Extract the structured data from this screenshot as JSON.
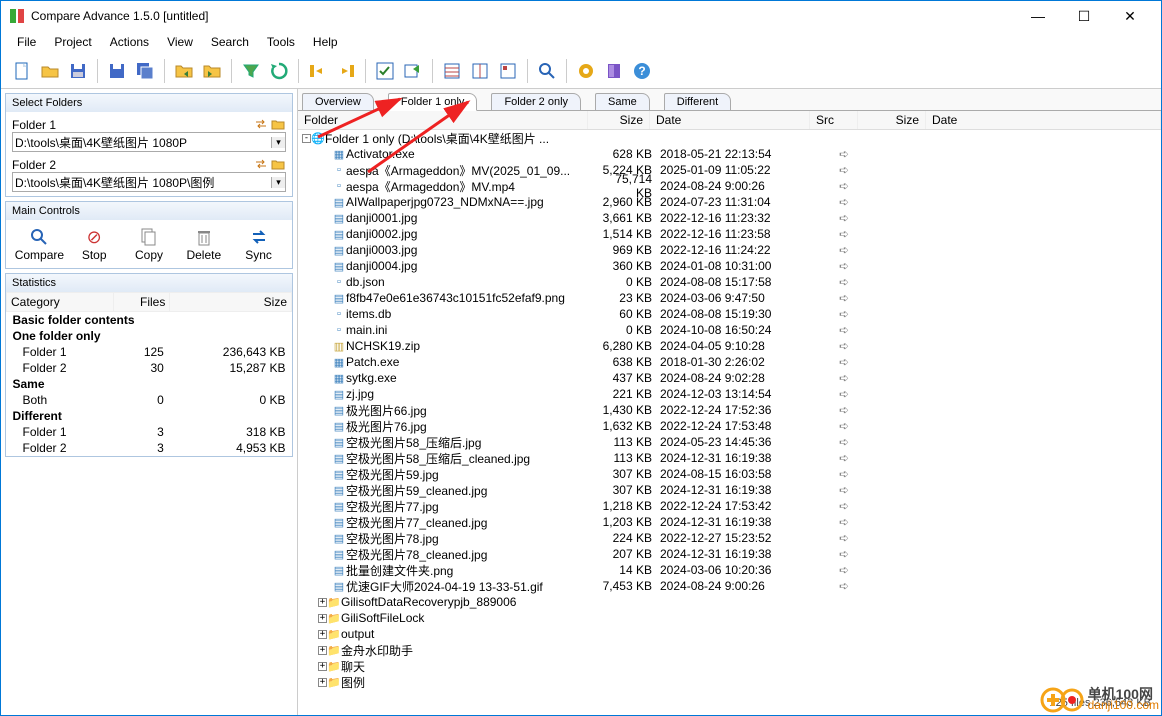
{
  "window": {
    "title": "Compare Advance 1.5.0 [untitled]"
  },
  "menu": [
    "File",
    "Project",
    "Actions",
    "View",
    "Search",
    "Tools",
    "Help"
  ],
  "sidebar": {
    "select_folders": {
      "title": "Select Folders",
      "folder1_label": "Folder 1",
      "folder1_path": "D:\\tools\\桌面\\4K壁纸图片 1080P",
      "folder2_label": "Folder 2",
      "folder2_path": "D:\\tools\\桌面\\4K壁纸图片 1080P\\图例"
    },
    "main_controls": {
      "title": "Main Controls",
      "buttons": [
        "Compare",
        "Stop",
        "Copy",
        "Delete",
        "Sync"
      ]
    },
    "statistics": {
      "title": "Statistics",
      "headers": [
        "Category",
        "Files",
        "Size"
      ],
      "groups": [
        {
          "label": "Basic folder contents"
        },
        {
          "label": "One folder only",
          "rows": [
            {
              "label": "Folder 1",
              "files": "125",
              "size": "236,643 KB"
            },
            {
              "label": "Folder 2",
              "files": "30",
              "size": "15,287 KB"
            }
          ]
        },
        {
          "label": "Same",
          "rows": [
            {
              "label": "Both",
              "files": "0",
              "size": "0 KB"
            }
          ]
        },
        {
          "label": "Different",
          "rows": [
            {
              "label": "Folder 1",
              "files": "3",
              "size": "318 KB"
            },
            {
              "label": "Folder 2",
              "files": "3",
              "size": "4,953 KB"
            }
          ]
        }
      ]
    }
  },
  "tabs": [
    "Overview",
    "Folder 1 only",
    "Folder 2 only",
    "Same",
    "Different"
  ],
  "columns": [
    "Folder",
    "Size",
    "Date",
    "Src",
    "Size",
    "Date"
  ],
  "root_label": "Folder 1 only (D:\\tools\\桌面\\4K壁纸图片 ...",
  "files": [
    {
      "name": "Activator.exe",
      "size": "628 KB",
      "date": "2018-05-21 22:13:54",
      "ico": "exe"
    },
    {
      "name": "aespa《Armageddon》MV(2025_01_09...",
      "size": "5,224 KB",
      "date": "2025-01-09 11:05:22",
      "ico": "file"
    },
    {
      "name": "aespa《Armageddon》MV.mp4",
      "size": "75,714 KB",
      "date": "2024-08-24 9:00:26",
      "ico": "file"
    },
    {
      "name": "AIWallpaperjpg0723_NDMxNA==.jpg",
      "size": "2,960 KB",
      "date": "2024-07-23 11:31:04",
      "ico": "img"
    },
    {
      "name": "danji0001.jpg",
      "size": "3,661 KB",
      "date": "2022-12-16 11:23:32",
      "ico": "img"
    },
    {
      "name": "danji0002.jpg",
      "size": "1,514 KB",
      "date": "2022-12-16 11:23:58",
      "ico": "img"
    },
    {
      "name": "danji0003.jpg",
      "size": "969 KB",
      "date": "2022-12-16 11:24:22",
      "ico": "img"
    },
    {
      "name": "danji0004.jpg",
      "size": "360 KB",
      "date": "2024-01-08 10:31:00",
      "ico": "img"
    },
    {
      "name": "db.json",
      "size": "0 KB",
      "date": "2024-08-08 15:17:58",
      "ico": "file"
    },
    {
      "name": "f8fb47e0e61e36743c10151fc52efaf9.png",
      "size": "23 KB",
      "date": "2024-03-06 9:47:50",
      "ico": "img"
    },
    {
      "name": "items.db",
      "size": "60 KB",
      "date": "2024-08-08 15:19:30",
      "ico": "file"
    },
    {
      "name": "main.ini",
      "size": "0 KB",
      "date": "2024-10-08 16:50:24",
      "ico": "file"
    },
    {
      "name": "NCHSK19.zip",
      "size": "6,280 KB",
      "date": "2024-04-05 9:10:28",
      "ico": "zip"
    },
    {
      "name": "Patch.exe",
      "size": "638 KB",
      "date": "2018-01-30 2:26:02",
      "ico": "exe"
    },
    {
      "name": "sytkg.exe",
      "size": "437 KB",
      "date": "2024-08-24 9:02:28",
      "ico": "exe"
    },
    {
      "name": "zj.jpg",
      "size": "221 KB",
      "date": "2024-12-03 13:14:54",
      "ico": "img"
    },
    {
      "name": "极光图片66.jpg",
      "size": "1,430 KB",
      "date": "2022-12-24 17:52:36",
      "ico": "img"
    },
    {
      "name": "极光图片76.jpg",
      "size": "1,632 KB",
      "date": "2022-12-24 17:53:48",
      "ico": "img"
    },
    {
      "name": "空极光图片58_压缩后.jpg",
      "size": "113 KB",
      "date": "2024-05-23 14:45:36",
      "ico": "img"
    },
    {
      "name": "空极光图片58_压缩后_cleaned.jpg",
      "size": "113 KB",
      "date": "2024-12-31 16:19:38",
      "ico": "img"
    },
    {
      "name": "空极光图片59.jpg",
      "size": "307 KB",
      "date": "2024-08-15 16:03:58",
      "ico": "img"
    },
    {
      "name": "空极光图片59_cleaned.jpg",
      "size": "307 KB",
      "date": "2024-12-31 16:19:38",
      "ico": "img"
    },
    {
      "name": "空极光图片77.jpg",
      "size": "1,218 KB",
      "date": "2022-12-24 17:53:42",
      "ico": "img"
    },
    {
      "name": "空极光图片77_cleaned.jpg",
      "size": "1,203 KB",
      "date": "2024-12-31 16:19:38",
      "ico": "img"
    },
    {
      "name": "空极光图片78.jpg",
      "size": "224 KB",
      "date": "2022-12-27 15:23:52",
      "ico": "img"
    },
    {
      "name": "空极光图片78_cleaned.jpg",
      "size": "207 KB",
      "date": "2024-12-31 16:19:38",
      "ico": "img"
    },
    {
      "name": "批量创建文件夹.png",
      "size": "14 KB",
      "date": "2024-03-06 10:20:36",
      "ico": "img"
    },
    {
      "name": "优速GIF大师2024-04-19 13-33-51.gif",
      "size": "7,453 KB",
      "date": "2024-08-24 9:00:26",
      "ico": "img"
    }
  ],
  "subfolders": [
    "GilisoftDataRecoverypjb_889006",
    "GiliSoftFileLock",
    "output",
    "金舟水印助手",
    "聊天",
    "图例"
  ],
  "status": "125 files 236,643 KB",
  "watermark": {
    "brand": "单机100网",
    "url": "danji100.com"
  }
}
